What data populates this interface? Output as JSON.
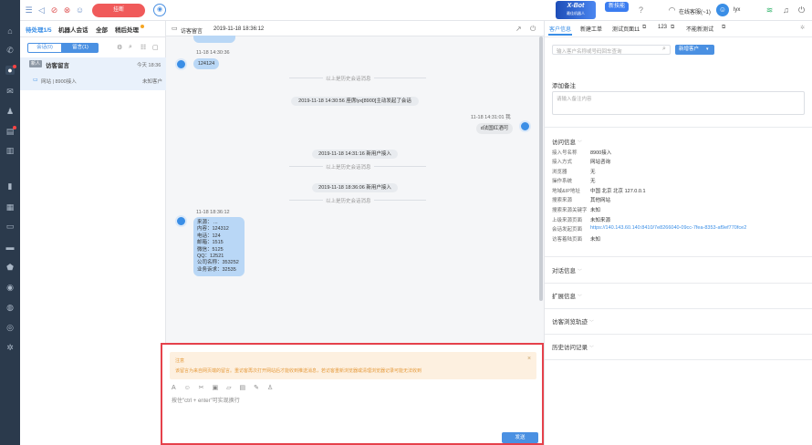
{
  "topbar": {
    "hangup_label": "挂断",
    "banner_title": "X-Bot",
    "banner_sub": "最佳机器人",
    "banner_new": "新技能",
    "agent_status": "在线客服(~1)",
    "user_name": "lyx"
  },
  "list": {
    "tabs": [
      "待处理1/5",
      "机器人会话",
      "全部",
      "稍后处理"
    ],
    "seg_session": "会话(0)",
    "seg_message": "留言(1)",
    "item": {
      "badge": "新人",
      "title": "访客留言",
      "time": "今天 18:36",
      "source": "网站 | 8900接入",
      "status": "未知客户"
    }
  },
  "chat": {
    "header_title": "访客留言",
    "header_time": "2019-11-18 18:36:12",
    "msgs": [
      {
        "time": "11-18 14:30:36",
        "text": "124124"
      },
      {
        "time": "11-18 14:31:01 我",
        "text": "d法国红酒可"
      },
      {
        "time": "11-18 18:36:12"
      }
    ],
    "history_hint": "以上是历史会话消息",
    "sys1": "2019-11-18 14:30:56 座席lyx[8900]主动发起了会话",
    "sys2": "2019-11-18 14:31:16 新用户接入",
    "sys3": "2019-11-18 18:36:06 新用户接入",
    "form_lines": [
      "来源：  ...",
      "内容：124312",
      "电话：124",
      "邮箱：1515",
      "微信：5125",
      "QQ：12521",
      "公司名称：353252",
      "业务诉求：32535"
    ]
  },
  "input": {
    "notice_title": "注意",
    "notice_text": "该留言为来自网页端的留言。重访客再次打开网站后才能收到推送消息，若访客重新浏览器或清理浏览器记录可能无法收到",
    "placeholder": "按住\"ctrl + enter\"可实现换行",
    "send_label": "发送"
  },
  "right": {
    "tabs": [
      "客户信息",
      "新建工单",
      "测试页面11",
      "123",
      "不能新测试"
    ],
    "search_placeholder": "输入客户名称或号码回车查询",
    "new_customer": "新增客户",
    "note_label": "添加备注",
    "note_placeholder": "请输入备注内容",
    "visit_section": "访问信息",
    "visit_rows": [
      {
        "k": "接入号名称",
        "v": "8900接入"
      },
      {
        "k": "接入方式",
        "v": "网站咨询"
      },
      {
        "k": "浏览器",
        "v": "无"
      },
      {
        "k": "操作系统",
        "v": "无"
      },
      {
        "k": "地域&IP地址",
        "v": "中国 北京 北京 127.0.0.1"
      },
      {
        "k": "搜索来源",
        "v": "其他网站"
      },
      {
        "k": "搜索来源关键字",
        "v": "未知"
      },
      {
        "k": "上级来源页面",
        "v": "未知来源"
      },
      {
        "k": "会话发起页面",
        "v": "https://140.143.60.140:8410/7e8266040-09cc-7fea-8353-af9ef770fce2"
      },
      {
        "k": "访客着陆页面",
        "v": "未知"
      }
    ],
    "sections": [
      "对话信息",
      "扩展信息",
      "访客浏览轨迹",
      "历史访问记录"
    ]
  },
  "colors": {
    "accent": "#3a8ee6",
    "danger": "#f05a5a",
    "rail": "#2b3a4c"
  }
}
